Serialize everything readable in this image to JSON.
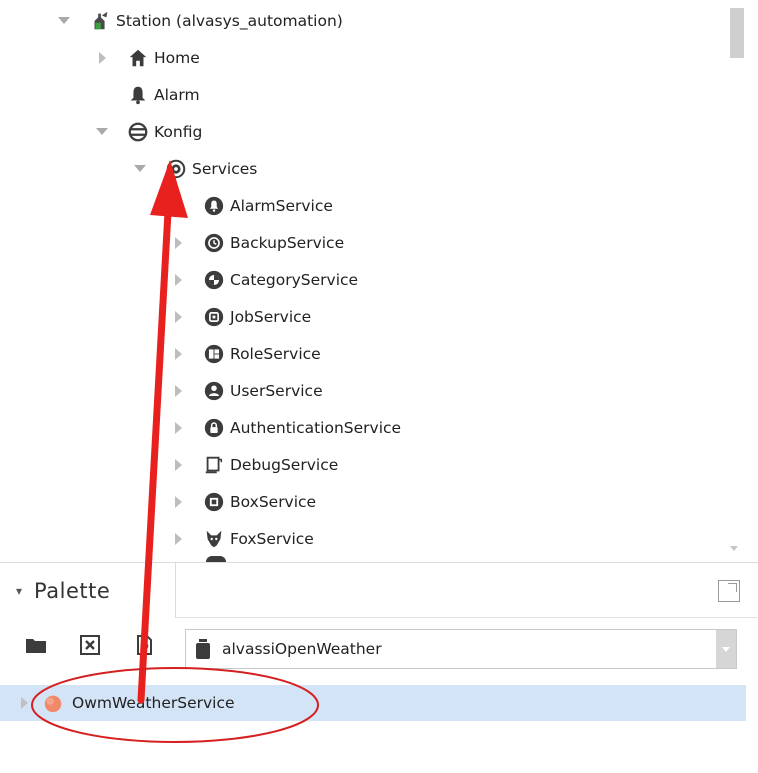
{
  "tree": {
    "items": [
      {
        "label": "Station (alvasys_automation)",
        "icon": "station-icon",
        "expanded": true
      },
      {
        "label": "Home",
        "icon": "home-icon",
        "expanded": false
      },
      {
        "label": "Alarm",
        "icon": "bell-icon"
      },
      {
        "label": "Konfig",
        "icon": "database-icon",
        "expanded": true
      },
      {
        "label": "Services",
        "icon": "services-icon",
        "expanded": true
      },
      {
        "label": "AlarmService",
        "icon": "alarm-service-icon"
      },
      {
        "label": "BackupService",
        "icon": "backup-service-icon",
        "expanded": false
      },
      {
        "label": "CategoryService",
        "icon": "category-service-icon",
        "expanded": false
      },
      {
        "label": "JobService",
        "icon": "job-service-icon",
        "expanded": false
      },
      {
        "label": "RoleService",
        "icon": "role-service-icon",
        "expanded": false
      },
      {
        "label": "UserService",
        "icon": "user-service-icon",
        "expanded": false
      },
      {
        "label": "AuthenticationService",
        "icon": "lock-service-icon",
        "expanded": false
      },
      {
        "label": "DebugService",
        "icon": "debug-service-icon",
        "expanded": false
      },
      {
        "label": "BoxService",
        "icon": "box-service-icon",
        "expanded": false
      },
      {
        "label": "FoxService",
        "icon": "fox-service-icon",
        "expanded": false
      }
    ]
  },
  "palette": {
    "title": "Palette",
    "module_selector": {
      "selected": "alvassiOpenWeather"
    },
    "items": [
      {
        "label": "OwmWeatherService",
        "icon": "weather-service-icon",
        "selected": true
      }
    ]
  },
  "colors": {
    "selection": "#d3e4f7",
    "annotation_red": "#e8201e",
    "icon_dark": "#3c3c3c"
  }
}
